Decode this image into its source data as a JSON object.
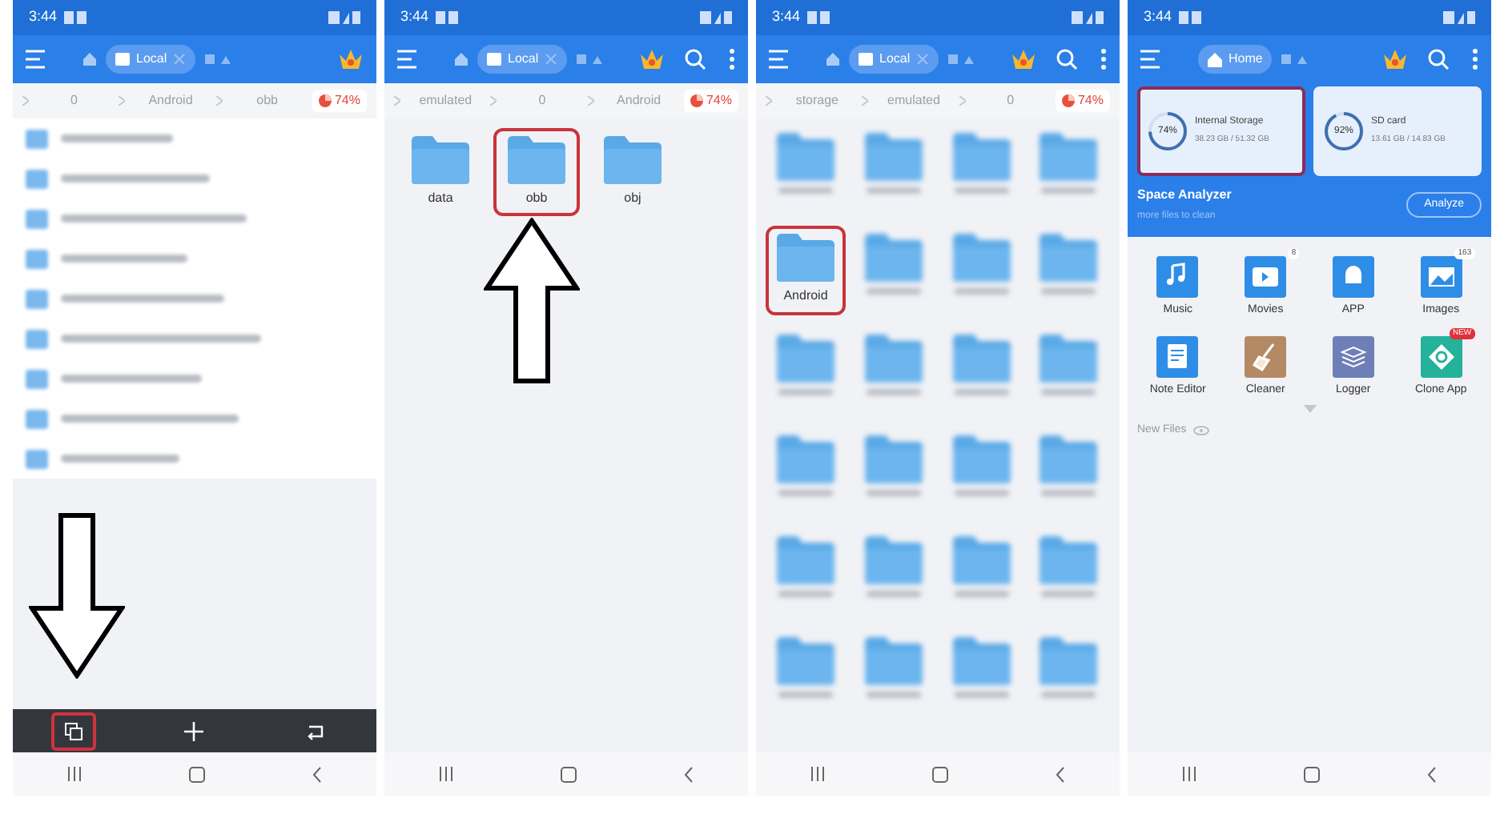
{
  "panels": [
    {
      "kind": "file_list",
      "status_time": "3:44",
      "tab_label": "Local",
      "search_shown": false,
      "breadcrumbs": [
        "0",
        "Android",
        "obb"
      ],
      "storage_badge": "74%",
      "overlay": {
        "kind": "down_arrow"
      },
      "bottom_toolbar": [
        {
          "selected": true
        },
        {
          "selected": false
        },
        {
          "selected": false
        }
      ]
    },
    {
      "kind": "folder_row",
      "status_time": "3:44",
      "tab_label": "Local",
      "search_shown": true,
      "breadcrumbs": [
        "emulated",
        "0",
        "Android"
      ],
      "storage_badge": "74%",
      "folders": [
        {
          "label": "data",
          "selected": false
        },
        {
          "label": "obb",
          "selected": true
        },
        {
          "label": "obj",
          "selected": false
        }
      ],
      "overlay": {
        "kind": "up_arrow"
      }
    },
    {
      "kind": "folder_grid",
      "status_time": "3:44",
      "tab_label": "Local",
      "search_shown": true,
      "breadcrumbs": [
        "storage",
        "emulated",
        "0"
      ],
      "storage_badge": "74%",
      "folders": [
        {
          "blurred": true,
          "selected": false
        },
        {
          "blurred": true,
          "selected": false
        },
        {
          "blurred": true,
          "selected": false
        },
        {
          "blurred": true,
          "selected": false
        },
        {
          "blurred": false,
          "label": "Android",
          "selected": true
        },
        {
          "blurred": true,
          "selected": false
        },
        {
          "blurred": true,
          "selected": false
        },
        {
          "blurred": true,
          "selected": false
        },
        {
          "blurred": true,
          "selected": false
        },
        {
          "blurred": true,
          "selected": false
        },
        {
          "blurred": true,
          "selected": false
        },
        {
          "blurred": true,
          "selected": false
        },
        {
          "blurred": true,
          "selected": false
        },
        {
          "blurred": true,
          "selected": false
        },
        {
          "blurred": true,
          "selected": false
        },
        {
          "blurred": true,
          "selected": false
        },
        {
          "blurred": true,
          "selected": false
        },
        {
          "blurred": true,
          "selected": false
        },
        {
          "blurred": true,
          "selected": false
        },
        {
          "blurred": true,
          "selected": false
        },
        {
          "blurred": true,
          "selected": false
        },
        {
          "blurred": true,
          "selected": false
        },
        {
          "blurred": true,
          "selected": false
        },
        {
          "blurred": true,
          "selected": false
        }
      ]
    },
    {
      "kind": "home",
      "status_time": "3:44",
      "tab_label": "Home",
      "search_shown": true,
      "storage_cards": [
        {
          "name": "Internal Storage",
          "percent": "74%",
          "usage": "38.23 GB / 51.32 GB",
          "selected": true
        },
        {
          "name": "SD card",
          "percent": "92%",
          "usage": "13.61 GB / 14.83 GB",
          "selected": false
        }
      ],
      "analyzer": {
        "title": "Space Analyzer",
        "subtitle": "more files to clean",
        "button": "Analyze"
      },
      "tools": [
        {
          "label": "Music"
        },
        {
          "label": "Movies",
          "badge": "8"
        },
        {
          "label": "APP"
        },
        {
          "label": "Images",
          "badge": "163"
        },
        {
          "label": "Note Editor"
        },
        {
          "label": "Cleaner"
        },
        {
          "label": "Logger"
        },
        {
          "label": "Clone App",
          "badge": "NEW"
        }
      ],
      "new_files": "New Files"
    }
  ]
}
